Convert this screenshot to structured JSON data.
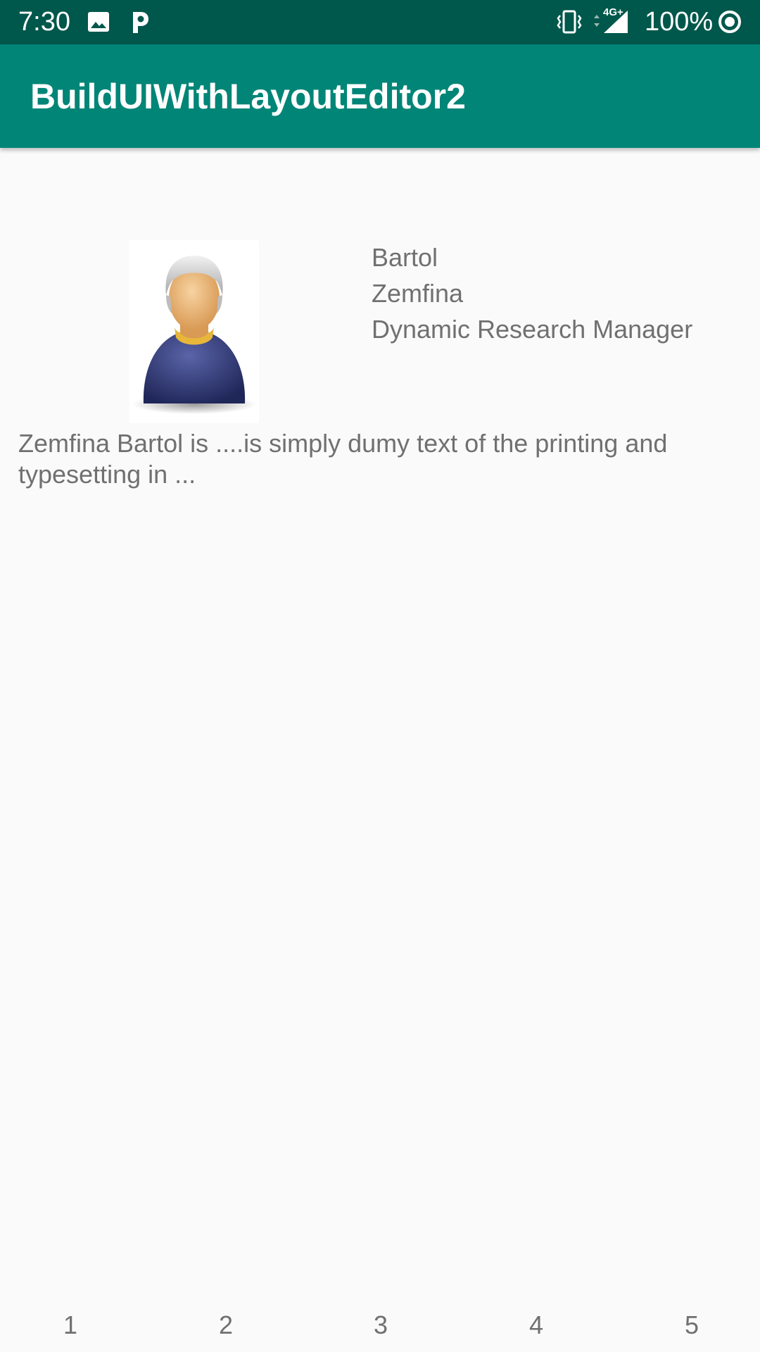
{
  "status_bar": {
    "time": "7:30",
    "battery": "100%",
    "network": "4G+",
    "icons": [
      "image-icon",
      "p-app-icon",
      "vibrate-icon",
      "signal-icon",
      "sync-circle-icon"
    ]
  },
  "app_bar": {
    "title": "BuildUIWithLayoutEditor2"
  },
  "profile": {
    "avatar_icon": "person-avatar-icon",
    "last_name": "Bartol",
    "first_name": "Zemfina",
    "job_title": "Dynamic Research Manager",
    "description": "Zemfina Bartol is ....is simply dumy text of the printing and typesetting in ..."
  },
  "bottom_nav": {
    "items": [
      "1",
      "2",
      "3",
      "4",
      "5"
    ]
  },
  "colors": {
    "status_bar": "#00574b",
    "app_bar": "#008577",
    "background": "#fafafa",
    "text": "#707070"
  }
}
